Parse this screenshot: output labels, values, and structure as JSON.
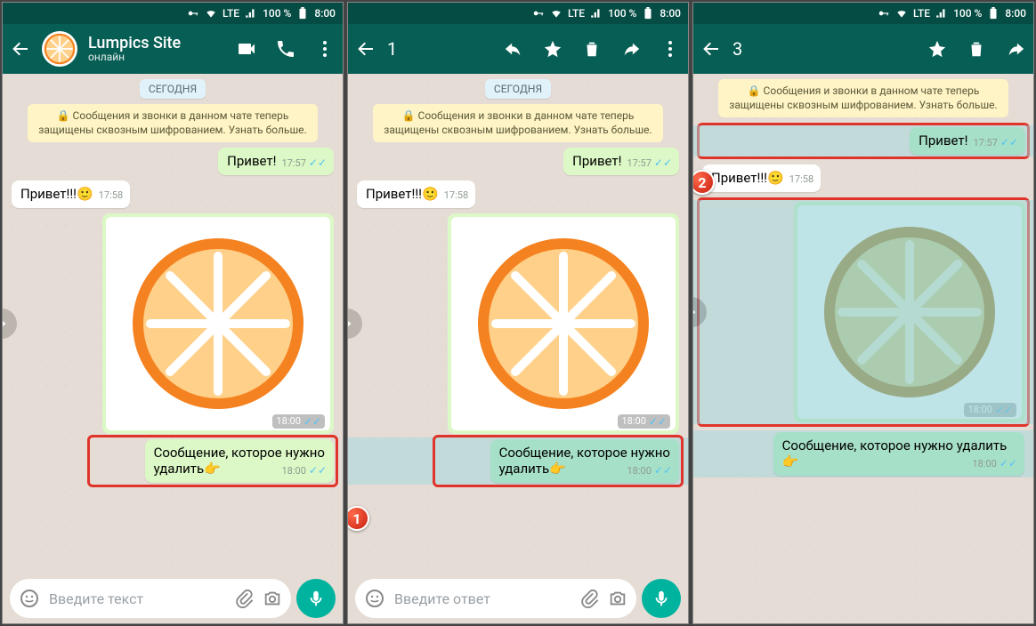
{
  "status": {
    "lte": "LTE",
    "signal_icon": "signal",
    "battery": "100 %",
    "time": "8:00"
  },
  "contact": {
    "name": "Lumpics Site",
    "presence": "онлайн"
  },
  "selection": {
    "count_panel2": "1",
    "count_panel3": "3"
  },
  "chat": {
    "date": "СЕГОДНЯ",
    "encryption": "🔒 Сообщения и звонки в данном чате теперь защищены сквозным шифрованием. Узнать больше.",
    "msg_out1": "Привет!",
    "msg_out1_time": "17:57",
    "msg_in1": "Привет!!!🙂",
    "msg_in1_time": "17:58",
    "img_time": "18:00",
    "msg_out2": "Сообщение, которое нужно удалить👉",
    "msg_out2_time": "18:00"
  },
  "input": {
    "placeholder_text": "Введите текст",
    "placeholder_reply": "Введите ответ"
  },
  "steps": {
    "one": "1",
    "two": "2"
  }
}
